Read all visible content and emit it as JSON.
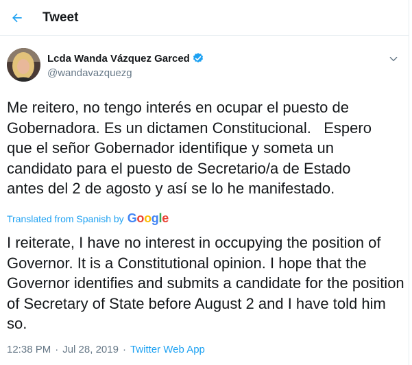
{
  "header": {
    "title": "Tweet",
    "back_icon": "arrow-left-icon"
  },
  "author": {
    "display_name": "Lcda Wanda Vázquez Garced",
    "handle": "@wandavazquezg",
    "verified": true,
    "verified_color": "#1da1f2"
  },
  "tweet": {
    "text": "Me reitero, no tengo interés en ocupar el puesto de\nGobernadora. Es un dictamen Constitucional.   Espero\nque el señor Gobernador identifique y someta un\ncandidato para el puesto de Secretario/a de Estado\nantes del 2 de agosto y así se lo he manifestado.",
    "translated_from": "Translated from Spanish by",
    "translator": "Google",
    "translation": "I reiterate, I have no interest in occupying the position of Governor. It is a Constitutional opinion. I hope that the Governor identifies and submits a candidate for the position of Secretary of State before August 2 and I have told him so."
  },
  "meta": {
    "time": "12:38 PM",
    "date": "Jul 28, 2019",
    "separator": "·",
    "source": "Twitter Web App"
  },
  "colors": {
    "accent": "#1da1f2",
    "text": "#14171a",
    "secondary": "#657786"
  }
}
